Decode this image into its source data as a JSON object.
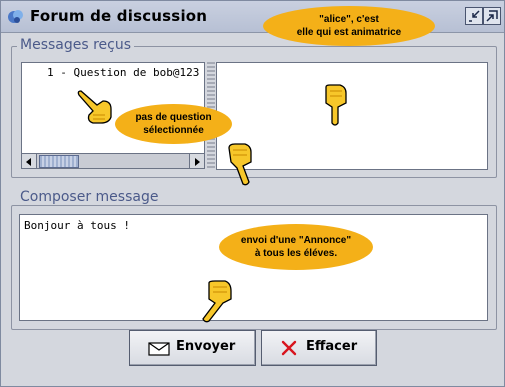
{
  "window": {
    "title": "Forum de discussion"
  },
  "received": {
    "group_title": "Messages reçus",
    "list_items": [
      "1 - Question de bob@123"
    ]
  },
  "compose": {
    "group_title": "Composer message",
    "text": "Bonjour à tous !"
  },
  "buttons": {
    "send": "Envoyer",
    "clear": "Effacer"
  },
  "annotations": {
    "top": [
      "\"alice\", c'est",
      "elle qui est animatrice"
    ],
    "middle": [
      "pas de question",
      "sélectionnée"
    ],
    "bottom": [
      "envoi d'une \"Annonce\"",
      "à tous les éléves."
    ]
  },
  "colors": {
    "bubble": "#f4b018",
    "group_title": "#4b5a8a",
    "window_bg": "#d4d7de"
  },
  "icons": [
    "app-icon",
    "minimize-icon",
    "maximize-icon",
    "envelope-icon",
    "x-icon",
    "pointing-hand-icon"
  ]
}
